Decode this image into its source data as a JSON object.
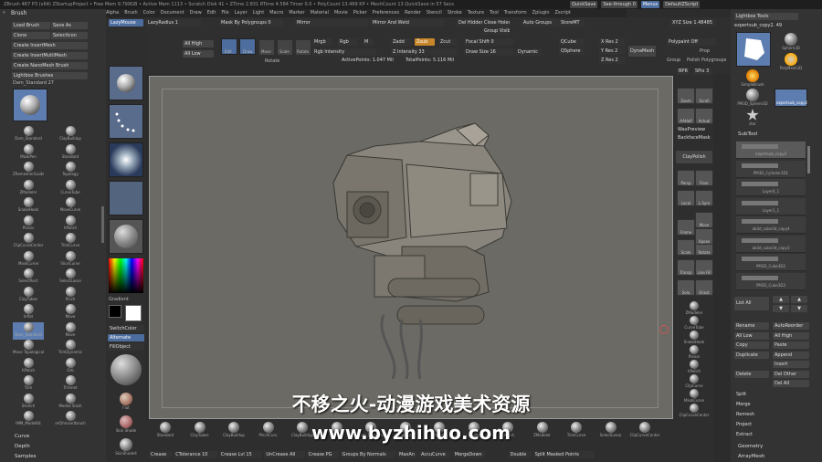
{
  "titlebar": {
    "text": "ZBrush 4R7 P3 (x64)   ZStartupProject  •  Free Mem 9.799GB  •  Active Mem 1113  •  Scratch Disk 41  •  ZTime 2.831 RTime 4.584 Timer 0.0 • PolyCount 13.469 KP • MeshCount 13  QuickSave in 57 Secs",
    "quicksave": "QuickSave",
    "seethrough": "See-through 0",
    "menus": "Menus",
    "script": "DefaultZScript"
  },
  "menu_items": [
    "Alpha",
    "Brush",
    "Color",
    "Document",
    "Draw",
    "Edit",
    "File",
    "Layer",
    "Light",
    "Macro",
    "Marker",
    "Material",
    "Movie",
    "Picker",
    "Preferences",
    "Render",
    "Stencil",
    "Stroke",
    "Texture",
    "Tool",
    "Transform",
    "Zplugin",
    "Zscript"
  ],
  "brush_panel": {
    "header": "Brush",
    "buttons": [
      "Load Brush",
      "Save As",
      "Clone",
      "SelectIcon",
      "Create InsertMesh",
      "Create InsertMultiMesh",
      "Create NanoMesh Brush",
      "Lightbox Brushes"
    ],
    "current": "Dam_Standard",
    "count": "27",
    "brushes": [
      "Dam_Standard",
      "ClayBuildup",
      "MaskPen",
      "Standard",
      "ZRemesherGuides",
      "Topology",
      "ZModeler",
      "CurveTube",
      "SnakeHook",
      "MoveCurve",
      "Planar",
      "hPolish",
      "ClipCurveCenter",
      "TrimCurve",
      "MaskCurve",
      "SliceCurve",
      "SelectRect",
      "SelectLasso",
      "ClayTubes",
      "Pinch",
      "Inflat",
      "Move",
      "Dam_Standard",
      "Move",
      "Move Topological",
      "TrimDynamic",
      "hPolish",
      "Orb",
      "Trim",
      "Trimnet",
      "Stretch",
      "Medial Slash",
      "IMM_ModelKit",
      "ref2hinsertbrush"
    ],
    "bottom": [
      "Curve",
      "Depth",
      "Samples"
    ]
  },
  "left_column": {
    "labels": [
      "Gradient",
      "SwitchColor",
      "Alternate",
      "FillObject"
    ],
    "slots": [
      "Dam_Standard",
      "DragRect",
      "Brush Alpha",
      "Texture Off",
      "Matcap"
    ],
    "materials": [
      "Flat",
      "Skin Shade",
      "SkinShade4"
    ]
  },
  "top_shelf": {
    "lazymouse": "LazyMouse",
    "lazyradius": "LazyRadius 1",
    "mask_by_polygroups": "Mask By Polygroups 0",
    "all_high": "All High",
    "all_low": "All Low",
    "edit": "Edit",
    "draw": "Draw",
    "move": "Move",
    "scale": "Scale",
    "rotate": "Rotate",
    "mrgb": "Mrgb",
    "rgb": "Rgb",
    "m": "M",
    "zadd": "Zadd",
    "zsub": "Zsub",
    "zcut": "Zcut",
    "rgb_intensity": "Rgb Intensity",
    "z_intensity": "Z Intensity 33",
    "focal_shift": "Focal Shift 0",
    "draw_size": "Draw Size 16",
    "dynamic": "Dynamic",
    "active_points": "ActivePoints: 1.047 Mil",
    "total_points": "TotalPoints: 5.116 Mil",
    "mirror": "Mirror",
    "mirror_weld": "Mirror And Weld",
    "del_hidden": "Del Hidden",
    "close_holes": "Close Holes",
    "group_visible": "Group Visible",
    "auto_groups": "Auto Groups",
    "store_mt": "StoreMT",
    "qcube": "QCube",
    "qsphere": "QSphere",
    "x_res": "X Res 2",
    "y_res": "Y Res 2",
    "z_res": "Z Res 2",
    "dynamesh": "DynaMesh",
    "xyz_size": "XYZ Size 1.48485",
    "polygroups": "Polygroups",
    "group": "Group",
    "polish": "Polish",
    "polypaint": "Polypaint Off",
    "prop": "Prop"
  },
  "right_toolbar": [
    "BPR",
    "SPix 3",
    "Scroll",
    "Zoom",
    "Actual",
    "AAHalf",
    "Persp",
    "Floor",
    "Local",
    "L.Sym",
    "Frame",
    "Move",
    "Scale",
    "Rotate",
    "Line Fill",
    "Transp",
    "Ghost",
    "Solo",
    "Xpose"
  ],
  "right_extra": {
    "wax_preview": "WaxPreview",
    "backface": "BackfaceMask",
    "claypolish": "ClayPolish"
  },
  "tool_panel": {
    "lightbox_tools": "Lightbox Tools",
    "current_tool": "ezpertsub_copy2. 49",
    "tool_names": [
      "ezpertsub_copy2",
      "Sphere3D",
      "PolyMesh3D",
      "SimpleBrush",
      "PM3D_Sphere3D",
      "ezpertsub_copy2",
      "star"
    ],
    "subtool_header": "SubTool",
    "subtools": [
      "ezpertsub_copy2",
      "PM3D_Cylinder3D1",
      "Layer6_1",
      "Layer1_1",
      "ab3d_cube3d_copy4",
      "ab3d_cube3d_copy3",
      "PM3D_Cube3D2",
      "PM3D_Cube3D3"
    ],
    "list_all": "List All",
    "actions": [
      [
        "Rename",
        "AutoReorder"
      ],
      [
        "All Low",
        "All High"
      ],
      [
        "Copy",
        "Paste"
      ],
      [
        "Duplicate",
        "Append"
      ],
      [
        "",
        "Insert"
      ],
      [
        "Delete",
        "Del Other"
      ],
      [
        "",
        "Del All"
      ]
    ],
    "single": [
      "Split",
      "Merge",
      "Remesh",
      "Project",
      "Extract"
    ],
    "bottom": [
      "Geometry",
      "ArrayMesh"
    ]
  },
  "bottom_shelf": {
    "brushes": [
      "Standard",
      "ClayTubes",
      "ClayBuildup",
      "PinchCurv",
      "ClayBuildup",
      "Move",
      "Dam_Standard",
      "Flatten",
      "Inflat",
      "Pinch",
      "hPolish",
      "ZModeler",
      "TrimCurve",
      "SelectLasso",
      "ClipCurveCenter"
    ],
    "row": [
      "Crease",
      "CTolerance 10",
      "Crease Lvl 15",
      "UnCrease All",
      "Crease PG",
      "Groups By Normals",
      "MaxAn",
      "AccuCurve",
      "MergeDown",
      "",
      "Double",
      "Split Masked Points"
    ]
  },
  "right_side_brushes": [
    "ZModeler",
    "CurveTube",
    "SnakeHook",
    "Planar",
    "hPolish",
    "ClipCurve",
    "MaskCurve",
    "ClipCurveCenter"
  ],
  "watermark": {
    "line1": "不移之火-动漫游戏美术资源",
    "line2": "www.byzhihuo.com"
  }
}
